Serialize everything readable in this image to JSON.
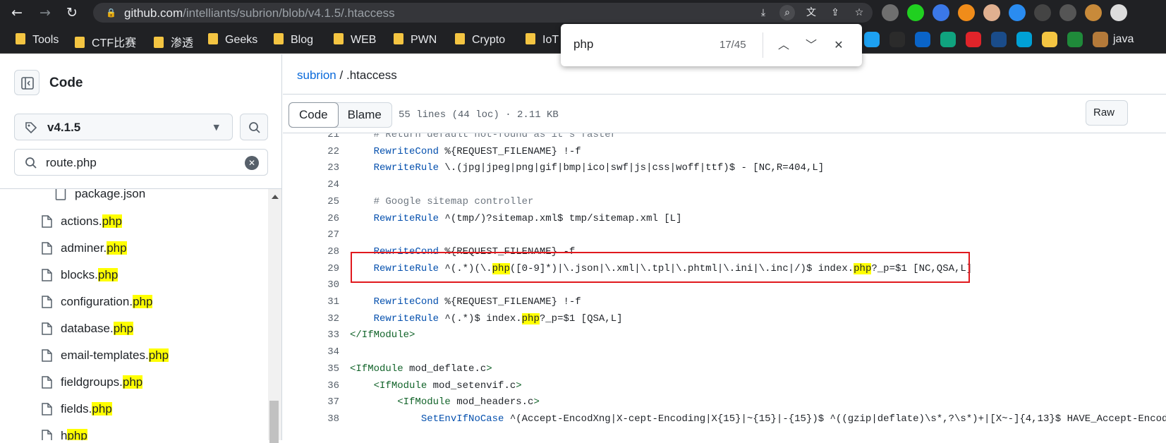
{
  "browser": {
    "url_host": "github.com",
    "url_path": "/intelliants/subrion/blob/v4.1.5/.htaccess"
  },
  "bookmarks": [
    "Tools",
    "CTF比赛",
    "渗透",
    "Geeks",
    "Blog",
    "WEB",
    "PWN",
    "Crypto",
    "IoT",
    "java"
  ],
  "findbar": {
    "query": "php",
    "count": "17/45"
  },
  "sidebar": {
    "title": "Code",
    "branch": "v4.1.5",
    "filter_value": "route.php",
    "files": [
      {
        "base": "package.json",
        "match": ""
      },
      {
        "base": "actions.",
        "match": "php"
      },
      {
        "base": "adminer.",
        "match": "php"
      },
      {
        "base": "blocks.",
        "match": "php"
      },
      {
        "base": "configuration.",
        "match": "php"
      },
      {
        "base": "database.",
        "match": "php"
      },
      {
        "base": "email-templates.",
        "match": "php"
      },
      {
        "base": "fieldgroups.",
        "match": "php"
      },
      {
        "base": "fields.",
        "match": "php"
      },
      {
        "base": "h",
        "match": "php"
      }
    ]
  },
  "main": {
    "breadcrumb_repo": "subrion",
    "breadcrumb_sep": "/",
    "breadcrumb_file": ".htaccess",
    "tab_code": "Code",
    "tab_blame": "Blame",
    "file_info": "55 lines (44 loc) · 2.11 KB",
    "raw_label": "Raw"
  },
  "code_lines": [
    {
      "n": "21",
      "text": "    # Return default not-found as it's faster"
    },
    {
      "n": "22",
      "text": "    RewriteCond %{REQUEST_FILENAME} !-f"
    },
    {
      "n": "23",
      "text": "    RewriteRule \\.(jpg|jpeg|png|gif|bmp|ico|swf|js|css|woff|ttf)$ - [NC,R=404,L]"
    },
    {
      "n": "24",
      "text": ""
    },
    {
      "n": "25",
      "text": "    # Google sitemap controller"
    },
    {
      "n": "26",
      "text": "    RewriteRule ^(tmp/)?sitemap.xml$ tmp/sitemap.xml [L]"
    },
    {
      "n": "27",
      "text": ""
    },
    {
      "n": "28",
      "text": "    RewriteCond %{REQUEST_FILENAME} -f"
    },
    {
      "n": "29",
      "text": "    RewriteRule ^(.*)(\\.php([0-9]*)|\\.json|\\.xml|\\.tpl|\\.phtml|\\.ini|\\.inc|/)$ index.php?_p=$1 [NC,QSA,L]"
    },
    {
      "n": "30",
      "text": ""
    },
    {
      "n": "31",
      "text": "    RewriteCond %{REQUEST_FILENAME} !-f"
    },
    {
      "n": "32",
      "text": "    RewriteRule ^(.*)$ index.php?_p=$1 [QSA,L]"
    },
    {
      "n": "33",
      "text": "</IfModule>"
    },
    {
      "n": "34",
      "text": ""
    },
    {
      "n": "35",
      "text": "<IfModule mod_deflate.c>"
    },
    {
      "n": "36",
      "text": "    <IfModule mod_setenvif.c>"
    },
    {
      "n": "37",
      "text": "        <IfModule mod_headers.c>"
    },
    {
      "n": "38",
      "text": "            SetEnvIfNoCase ^(Accept-EncodXng|X-cept-Encoding|X{15}|~{15}|-{15})$ ^((gzip|deflate)\\s*,?\\s*)+|[X~-]{4,13}$ HAVE_Accept-Encoding"
    }
  ],
  "colors": {
    "highlight": "#ffff00",
    "link": "#0969da",
    "redbox": "#e0191e"
  }
}
